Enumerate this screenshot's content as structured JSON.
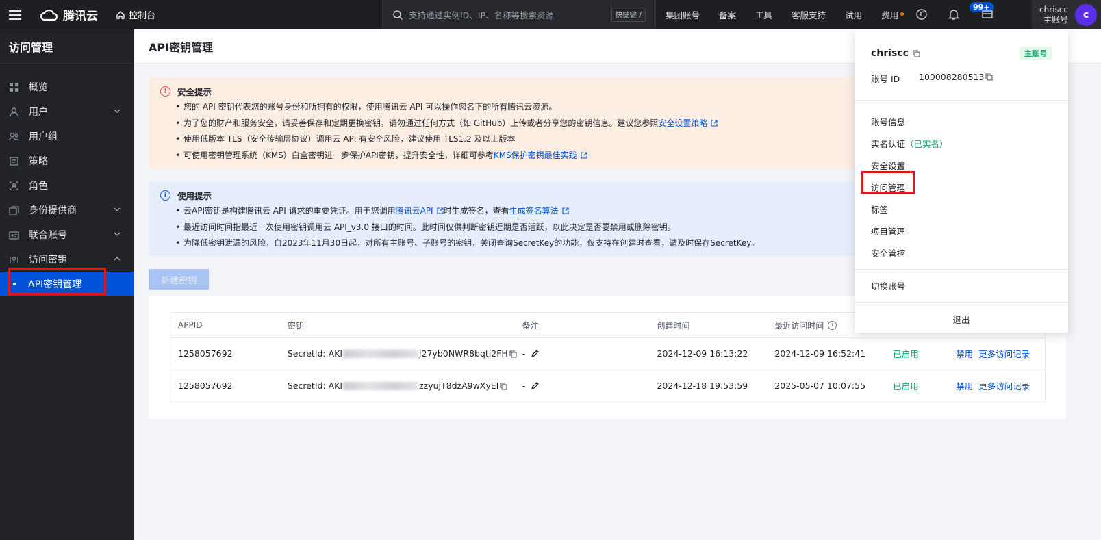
{
  "topbar": {
    "brand": "腾讯云",
    "console": "控制台",
    "search_placeholder": "支持通过实例ID、IP、名称等搜索资源",
    "shortcut": "快捷键 /",
    "links": [
      "集团账号",
      "备案",
      "工具",
      "客服支持",
      "试用",
      "费用"
    ],
    "notif_count": "99+",
    "account_name": "chriscc",
    "account_type": "主账号",
    "avatar_letter": "c"
  },
  "sidebar": {
    "title": "访问管理",
    "items": [
      {
        "label": "概览",
        "icon": "grid-icon",
        "expandable": false
      },
      {
        "label": "用户",
        "icon": "user-icon",
        "expandable": true
      },
      {
        "label": "用户组",
        "icon": "users-icon",
        "expandable": false
      },
      {
        "label": "策略",
        "icon": "policy-icon",
        "expandable": false
      },
      {
        "label": "角色",
        "icon": "role-icon",
        "expandable": false
      },
      {
        "label": "身份提供商",
        "icon": "idp-icon",
        "expandable": true
      },
      {
        "label": "联合账号",
        "icon": "federated-icon",
        "expandable": true
      },
      {
        "label": "访问密钥",
        "icon": "key-icon",
        "expandable": true
      }
    ],
    "active_sub": "API密钥管理"
  },
  "page": {
    "title": "API密钥管理",
    "security_notice": {
      "title": "安全提示",
      "items": [
        {
          "text": "您的 API 密钥代表您的账号身份和所拥有的权限，使用腾讯云 API 可以操作您名下的所有腾讯云资源。"
        },
        {
          "text": "为了您的财产和服务安全，请妥善保存和定期更换密钥，请勿通过任何方式（如 GitHub）上传或者分享您的密钥信息。建议您参照",
          "link": "安全设置策略"
        },
        {
          "text": "使用低版本 TLS（安全传输层协议）调用云 API 有安全风险，建议使用 TLS1.2 及以上版本"
        },
        {
          "text": "可使用密钥管理系统（KMS）白盒密钥进一步保护API密钥，提升安全性，详细可参考",
          "link": "KMS保护密钥最佳实践"
        }
      ]
    },
    "usage_notice": {
      "title": "使用提示",
      "item1_pre": "云API密钥是构建腾讯云 API 请求的重要凭证。用于您调用",
      "item1_link1": "腾讯云API",
      "item1_mid": "时生成签名，查看",
      "item1_link2": "生成签名算法",
      "item2": "最近访问时间指最近一次使用密钥调用云 API_v3.0 接口的时间。此时间仅供判断密钥近期是否活跃，以此决定是否要禁用或删除密钥。",
      "item3": "为降低密钥泄漏的风险，自2023年11月30日起，对所有主账号、子账号的密钥，关闭查询SecretKey的功能，仅支持在创建时查看，请及时保存SecretKey。"
    },
    "new_key_button": "新建密钥",
    "table": {
      "headers": [
        "APPID",
        "密钥",
        "备注",
        "创建时间",
        "最近访问时间"
      ],
      "rows": [
        {
          "appid": "1258057692",
          "key_prefix": "SecretId: AKI",
          "key_suffix": "j27yb0NWR8bqti2FH",
          "remark": "-",
          "created": "2024-12-09 16:13:22",
          "last_access": "2024-12-09 16:52:41",
          "status": "已启用",
          "action1": "禁用",
          "action2": "更多访问记录"
        },
        {
          "appid": "1258057692",
          "key_prefix": "SecretId: AKI",
          "key_suffix": "zzyujT8dzA9wXyEI",
          "remark": "-",
          "created": "2024-12-18 19:53:59",
          "last_access": "2025-05-07 10:07:55",
          "status": "已启用",
          "action1": "禁用",
          "action2": "更多访问记录"
        }
      ]
    }
  },
  "dropdown": {
    "name": "chriscc",
    "tag": "主账号",
    "id_label": "账号 ID",
    "id_value": "100008280513",
    "menu": [
      "账号信息",
      "实名认证",
      "安全设置",
      "访问管理",
      "标签",
      "项目管理",
      "安全管控"
    ],
    "verified": "（已实名）",
    "switch": "切换账号",
    "logout": "退出"
  },
  "colors": {
    "accent": "#0052d9",
    "highlight": "#e3161c",
    "success": "#00a870"
  }
}
